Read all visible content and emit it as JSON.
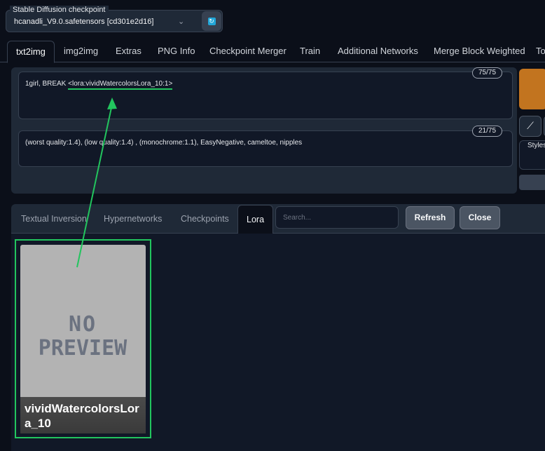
{
  "checkpoint": {
    "label": "Stable Diffusion checkpoint",
    "value": "hcanadli_V9.0.safetensors [cd301e2d16]",
    "refresh_icon": "refresh-icon"
  },
  "main_tabs": [
    "txt2img",
    "img2img",
    "Extras",
    "PNG Info",
    "Checkpoint Merger",
    "Train",
    "Additional Networks",
    "Merge Block Weighted",
    "To"
  ],
  "prompt": {
    "prefix": "1girl, BREAK ",
    "lora_tag": "<lora:vividWatercolorsLora_10:1>",
    "counter": "75/75"
  },
  "negative_prompt": {
    "text": "(worst quality:1.4), (low quality:1.4) , (monochrome:1.1), EasyNegative, cameltoe, nipples",
    "counter": "21/75"
  },
  "side": {
    "styles_label": "Styles",
    "generate_color": "#c2741f",
    "edit_icon": "pencil-icon"
  },
  "extra_networks": {
    "tabs": [
      "Textual Inversion",
      "Hypernetworks",
      "Checkpoints",
      "Lora"
    ],
    "search_placeholder": "Search...",
    "refresh_label": "Refresh",
    "close_label": "Close"
  },
  "card": {
    "name": "vividWatercolorsLora_10",
    "preview_line1": "NO",
    "preview_line2": "PREVIEW",
    "highlight_color": "#22c55e"
  }
}
